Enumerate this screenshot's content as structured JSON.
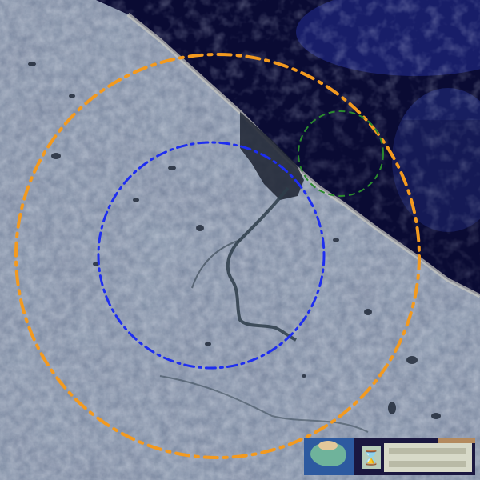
{
  "image": {
    "kind": "satellite-imagery",
    "palette": {
      "land": "#7f8ea5",
      "land_light": "#a9b8c6",
      "sea": "#0a0b33",
      "sea_glow": "#2a36a8",
      "ice": "#c7d3ef",
      "river": "#2e3d4a"
    }
  },
  "overlays": {
    "large_ring": {
      "color": "#f39a1f",
      "style": "dash-dot"
    },
    "medium_ring": {
      "color": "#1e2ef0",
      "style": "dash-dot"
    },
    "small_ring": {
      "color": "#2b8a2e",
      "style": "dashed"
    }
  },
  "hud": {
    "icon": "hourglass-icon",
    "glyph": "⌛",
    "colors": {
      "bg": "#1a1740",
      "panel": "#d7d9c8",
      "accent": "#b48a5e",
      "thumb": "#2d5aa0"
    }
  }
}
